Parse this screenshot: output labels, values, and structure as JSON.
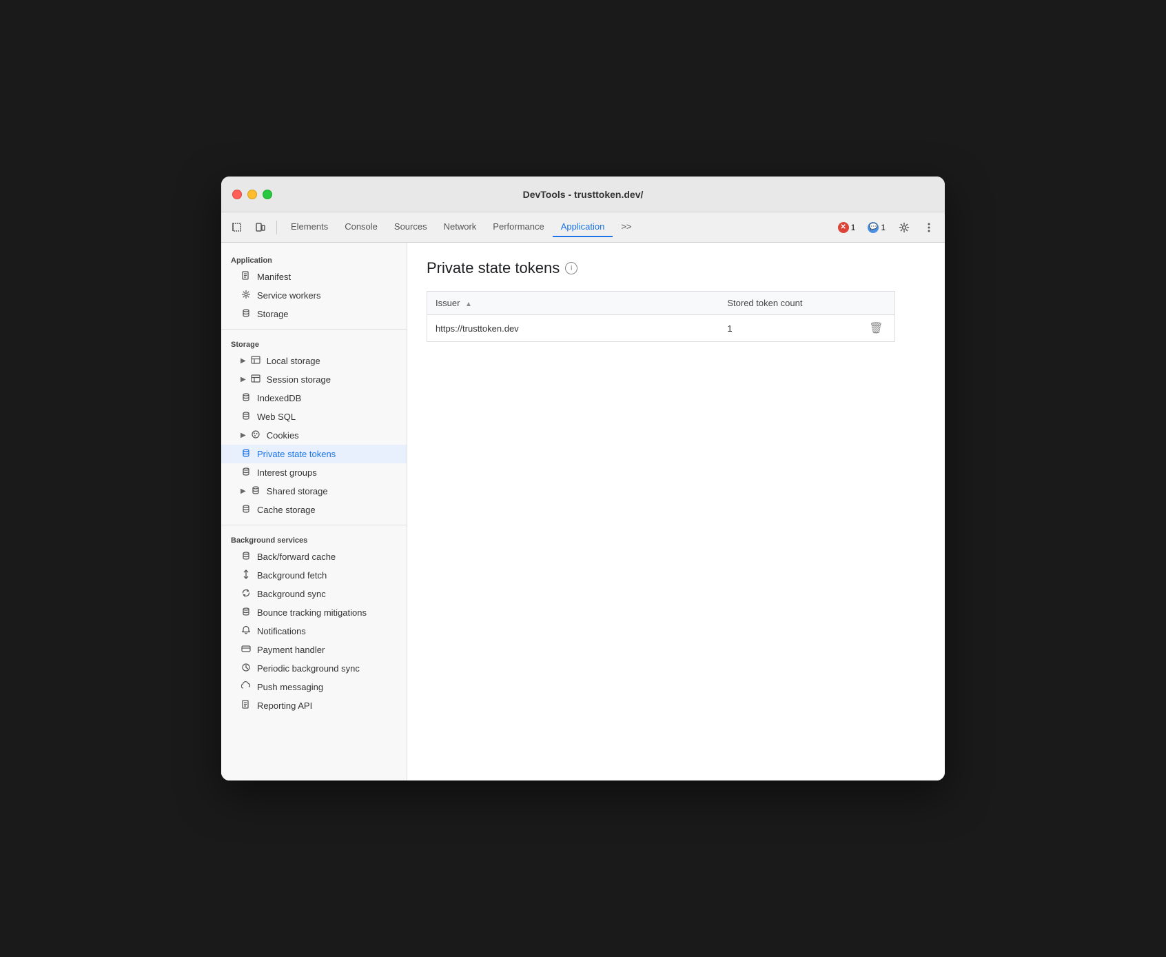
{
  "window": {
    "title": "DevTools - trusttoken.dev/"
  },
  "toolbar": {
    "tabs": [
      {
        "label": "Elements",
        "active": false
      },
      {
        "label": "Console",
        "active": false
      },
      {
        "label": "Sources",
        "active": false
      },
      {
        "label": "Network",
        "active": false
      },
      {
        "label": "Performance",
        "active": false
      },
      {
        "label": "Application",
        "active": true
      }
    ],
    "more_label": ">>",
    "error_count": "1",
    "warning_count": "1"
  },
  "sidebar": {
    "sections": [
      {
        "label": "Application",
        "items": [
          {
            "label": "Manifest",
            "icon": "file",
            "indent": 1
          },
          {
            "label": "Service workers",
            "icon": "gear",
            "indent": 1
          },
          {
            "label": "Storage",
            "icon": "database",
            "indent": 1
          }
        ]
      },
      {
        "label": "Storage",
        "items": [
          {
            "label": "Local storage",
            "icon": "table",
            "indent": 1,
            "expandable": true
          },
          {
            "label": "Session storage",
            "icon": "table",
            "indent": 1,
            "expandable": true
          },
          {
            "label": "IndexedDB",
            "icon": "database",
            "indent": 1
          },
          {
            "label": "Web SQL",
            "icon": "database",
            "indent": 1
          },
          {
            "label": "Cookies",
            "icon": "cookie",
            "indent": 1,
            "expandable": true
          },
          {
            "label": "Private state tokens",
            "icon": "database",
            "indent": 1,
            "active": true
          },
          {
            "label": "Interest groups",
            "icon": "database",
            "indent": 1
          },
          {
            "label": "Shared storage",
            "icon": "database",
            "indent": 1,
            "expandable": true
          },
          {
            "label": "Cache storage",
            "icon": "database",
            "indent": 1
          }
        ]
      },
      {
        "label": "Background services",
        "items": [
          {
            "label": "Back/forward cache",
            "icon": "database",
            "indent": 1
          },
          {
            "label": "Background fetch",
            "icon": "arrow-updown",
            "indent": 1
          },
          {
            "label": "Background sync",
            "icon": "sync",
            "indent": 1
          },
          {
            "label": "Bounce tracking mitigations",
            "icon": "database",
            "indent": 1
          },
          {
            "label": "Notifications",
            "icon": "bell",
            "indent": 1
          },
          {
            "label": "Payment handler",
            "icon": "card",
            "indent": 1
          },
          {
            "label": "Periodic background sync",
            "icon": "clock",
            "indent": 1
          },
          {
            "label": "Push messaging",
            "icon": "cloud",
            "indent": 1
          },
          {
            "label": "Reporting API",
            "icon": "file",
            "indent": 1
          }
        ]
      }
    ]
  },
  "panel": {
    "title": "Private state tokens",
    "table": {
      "columns": [
        {
          "label": "Issuer",
          "sortable": true
        },
        {
          "label": "Stored token count",
          "sortable": false
        },
        {
          "label": "",
          "sortable": false
        }
      ],
      "rows": [
        {
          "issuer": "https://trusttoken.dev",
          "count": "1"
        }
      ]
    }
  }
}
